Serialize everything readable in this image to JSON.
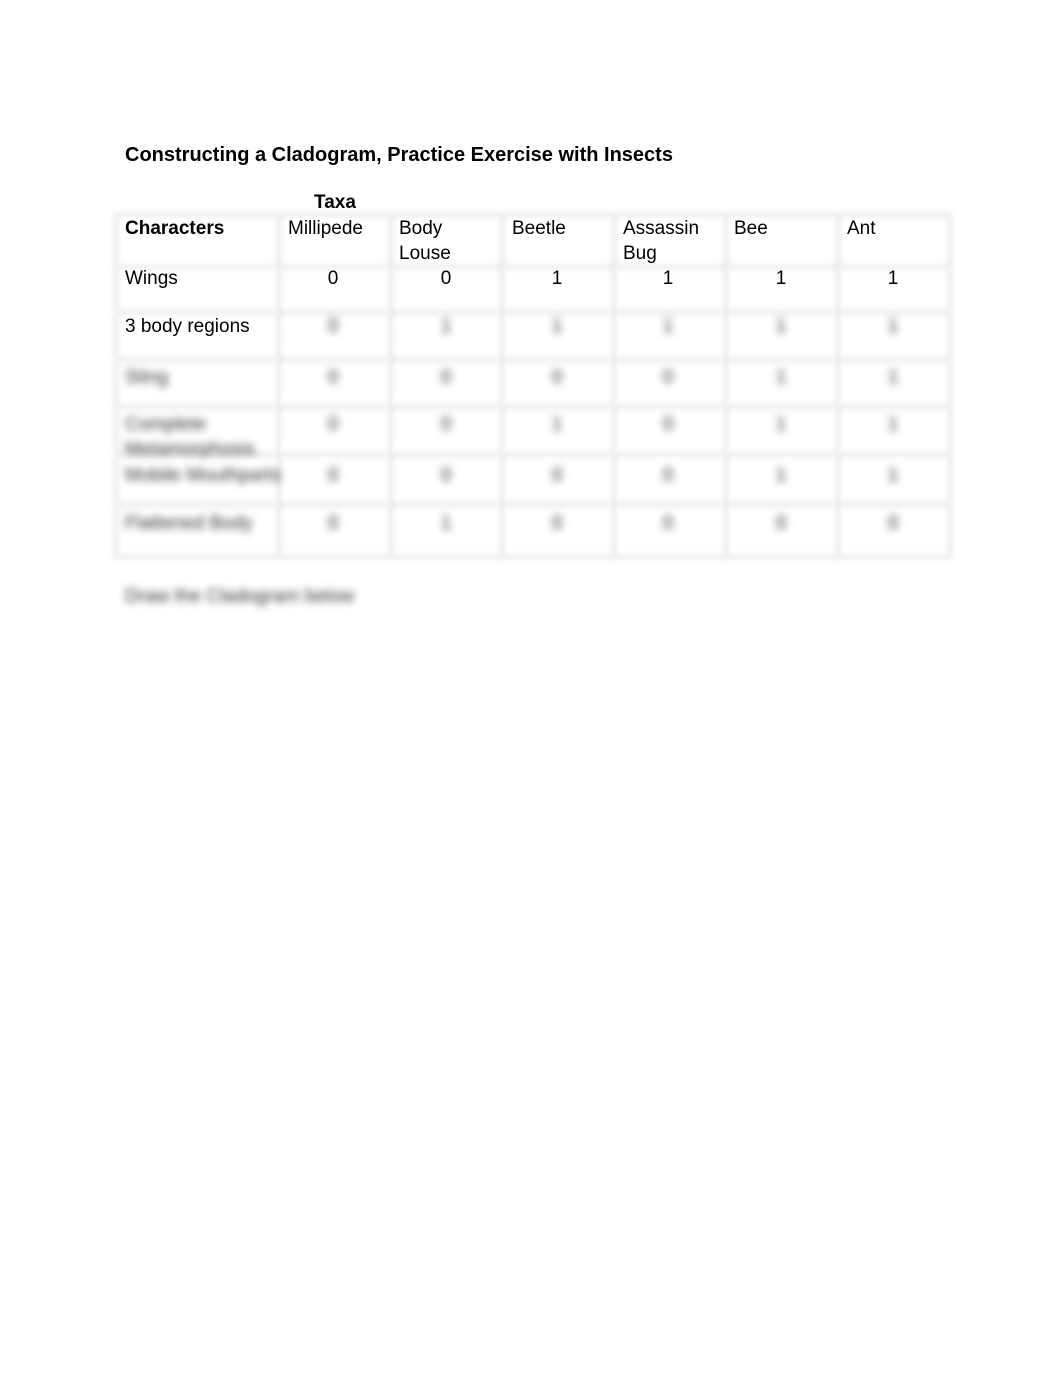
{
  "document": {
    "title": "Constructing a Cladogram, Practice Exercise with Insects",
    "taxa_label": "Taxa",
    "characters_label": "Characters",
    "taxa": [
      "Millipede",
      "Body Louse",
      "Beetle",
      "Assassin Bug",
      "Bee",
      "Ant"
    ],
    "rows": [
      {
        "character": "Wings",
        "values": [
          "0",
          "0",
          "1",
          "1",
          "1",
          "1"
        ]
      },
      {
        "character": "3 body regions",
        "values": [
          "0",
          "1",
          "1",
          "1",
          "1",
          "1"
        ]
      },
      {
        "character": "Sting",
        "values": [
          "0",
          "0",
          "0",
          "0",
          "1",
          "1"
        ]
      },
      {
        "character": "Complete Metamorphosis",
        "values": [
          "0",
          "0",
          "1",
          "0",
          "1",
          "1"
        ]
      },
      {
        "character": "Mobile Mouthparts",
        "values": [
          "0",
          "0",
          "0",
          "0",
          "1",
          "1"
        ]
      },
      {
        "character": "Flattened Body",
        "values": [
          "0",
          "1",
          "0",
          "0",
          "0",
          "0"
        ]
      }
    ],
    "footer": "Draw the Cladogram below"
  }
}
